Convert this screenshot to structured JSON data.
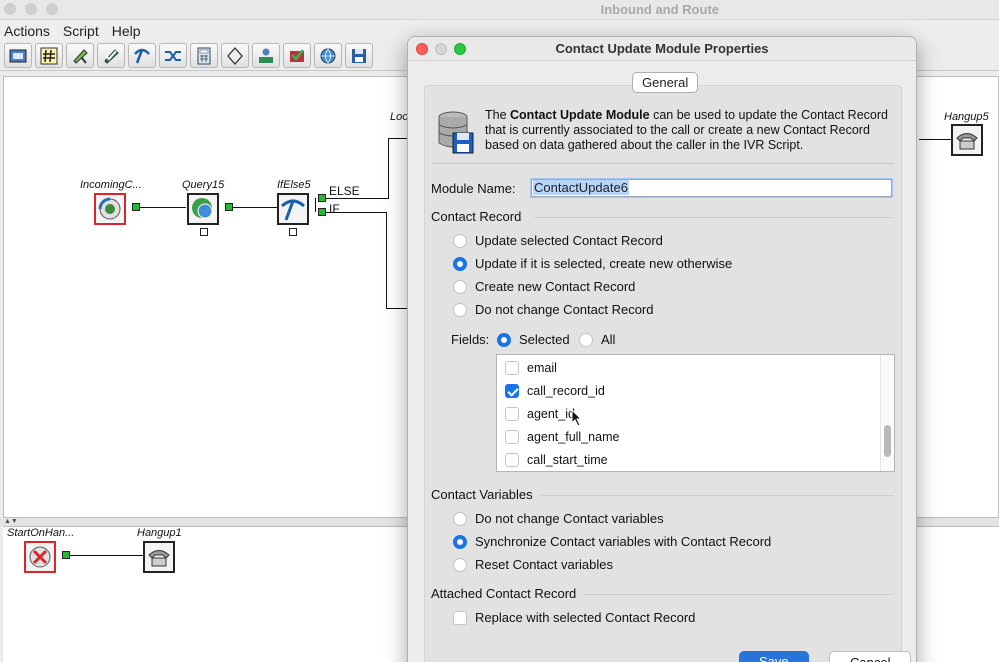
{
  "window": {
    "title": "Inbound and Route"
  },
  "menu": [
    "Actions",
    "Script",
    "Help"
  ],
  "toolbar": {
    "buttons": [
      "book-icon",
      "hash-icon",
      "edit-tag-icon",
      "check-tag-icon",
      "pick-icon",
      "shuffle-icon",
      "calculator-icon",
      "diamond-icon",
      "user-card-icon",
      "check-flag-icon",
      "globe-icon",
      "save-disk-icon"
    ]
  },
  "canvas": {
    "nodes": {
      "incoming": "IncomingC...",
      "query": "Query15",
      "ifelse": "IfElse5",
      "loop": "Loo",
      "hangup_top": "Hangup5",
      "start_on_hangup": "StartOnHan...",
      "hangup_bottom": "Hangup1"
    },
    "branches": {
      "else": "ELSE",
      "if": "IF"
    }
  },
  "dialog": {
    "title": "Contact Update Module Properties",
    "tab": "General",
    "description": {
      "prefix": "The ",
      "bold": "Contact Update Module",
      "suffix": " can be used to update the Contact Record that is currently associated to the call or create a new Contact Record based on data gathered about the caller in the IVR Script."
    },
    "module_name_label": "Module Name:",
    "module_name_value": "ContactUpdate6",
    "contact_record": {
      "heading": "Contact Record",
      "options": [
        {
          "label": "Update selected Contact Record",
          "selected": false
        },
        {
          "label": "Update if it is selected, create new otherwise",
          "selected": true
        },
        {
          "label": "Create new Contact Record",
          "selected": false
        },
        {
          "label": "Do not change Contact Record",
          "selected": false
        }
      ]
    },
    "fields": {
      "label": "Fields:",
      "selected_label": "Selected",
      "all_label": "All",
      "mode": "Selected",
      "items": [
        {
          "name": "email",
          "checked": false
        },
        {
          "name": "call_record_id",
          "checked": true
        },
        {
          "name": "agent_id",
          "checked": false
        },
        {
          "name": "agent_full_name",
          "checked": false
        },
        {
          "name": "call_start_time",
          "checked": false
        }
      ]
    },
    "contact_variables": {
      "heading": "Contact Variables",
      "options": [
        {
          "label": "Do not change Contact variables",
          "selected": false
        },
        {
          "label": "Synchronize Contact variables with Contact Record",
          "selected": true
        },
        {
          "label": "Reset Contact variables",
          "selected": false
        }
      ]
    },
    "attached": {
      "heading": "Attached Contact Record",
      "checkbox_label": "Replace with selected Contact Record",
      "checked": false
    },
    "buttons": {
      "save": "Save",
      "cancel": "Cancel"
    }
  }
}
